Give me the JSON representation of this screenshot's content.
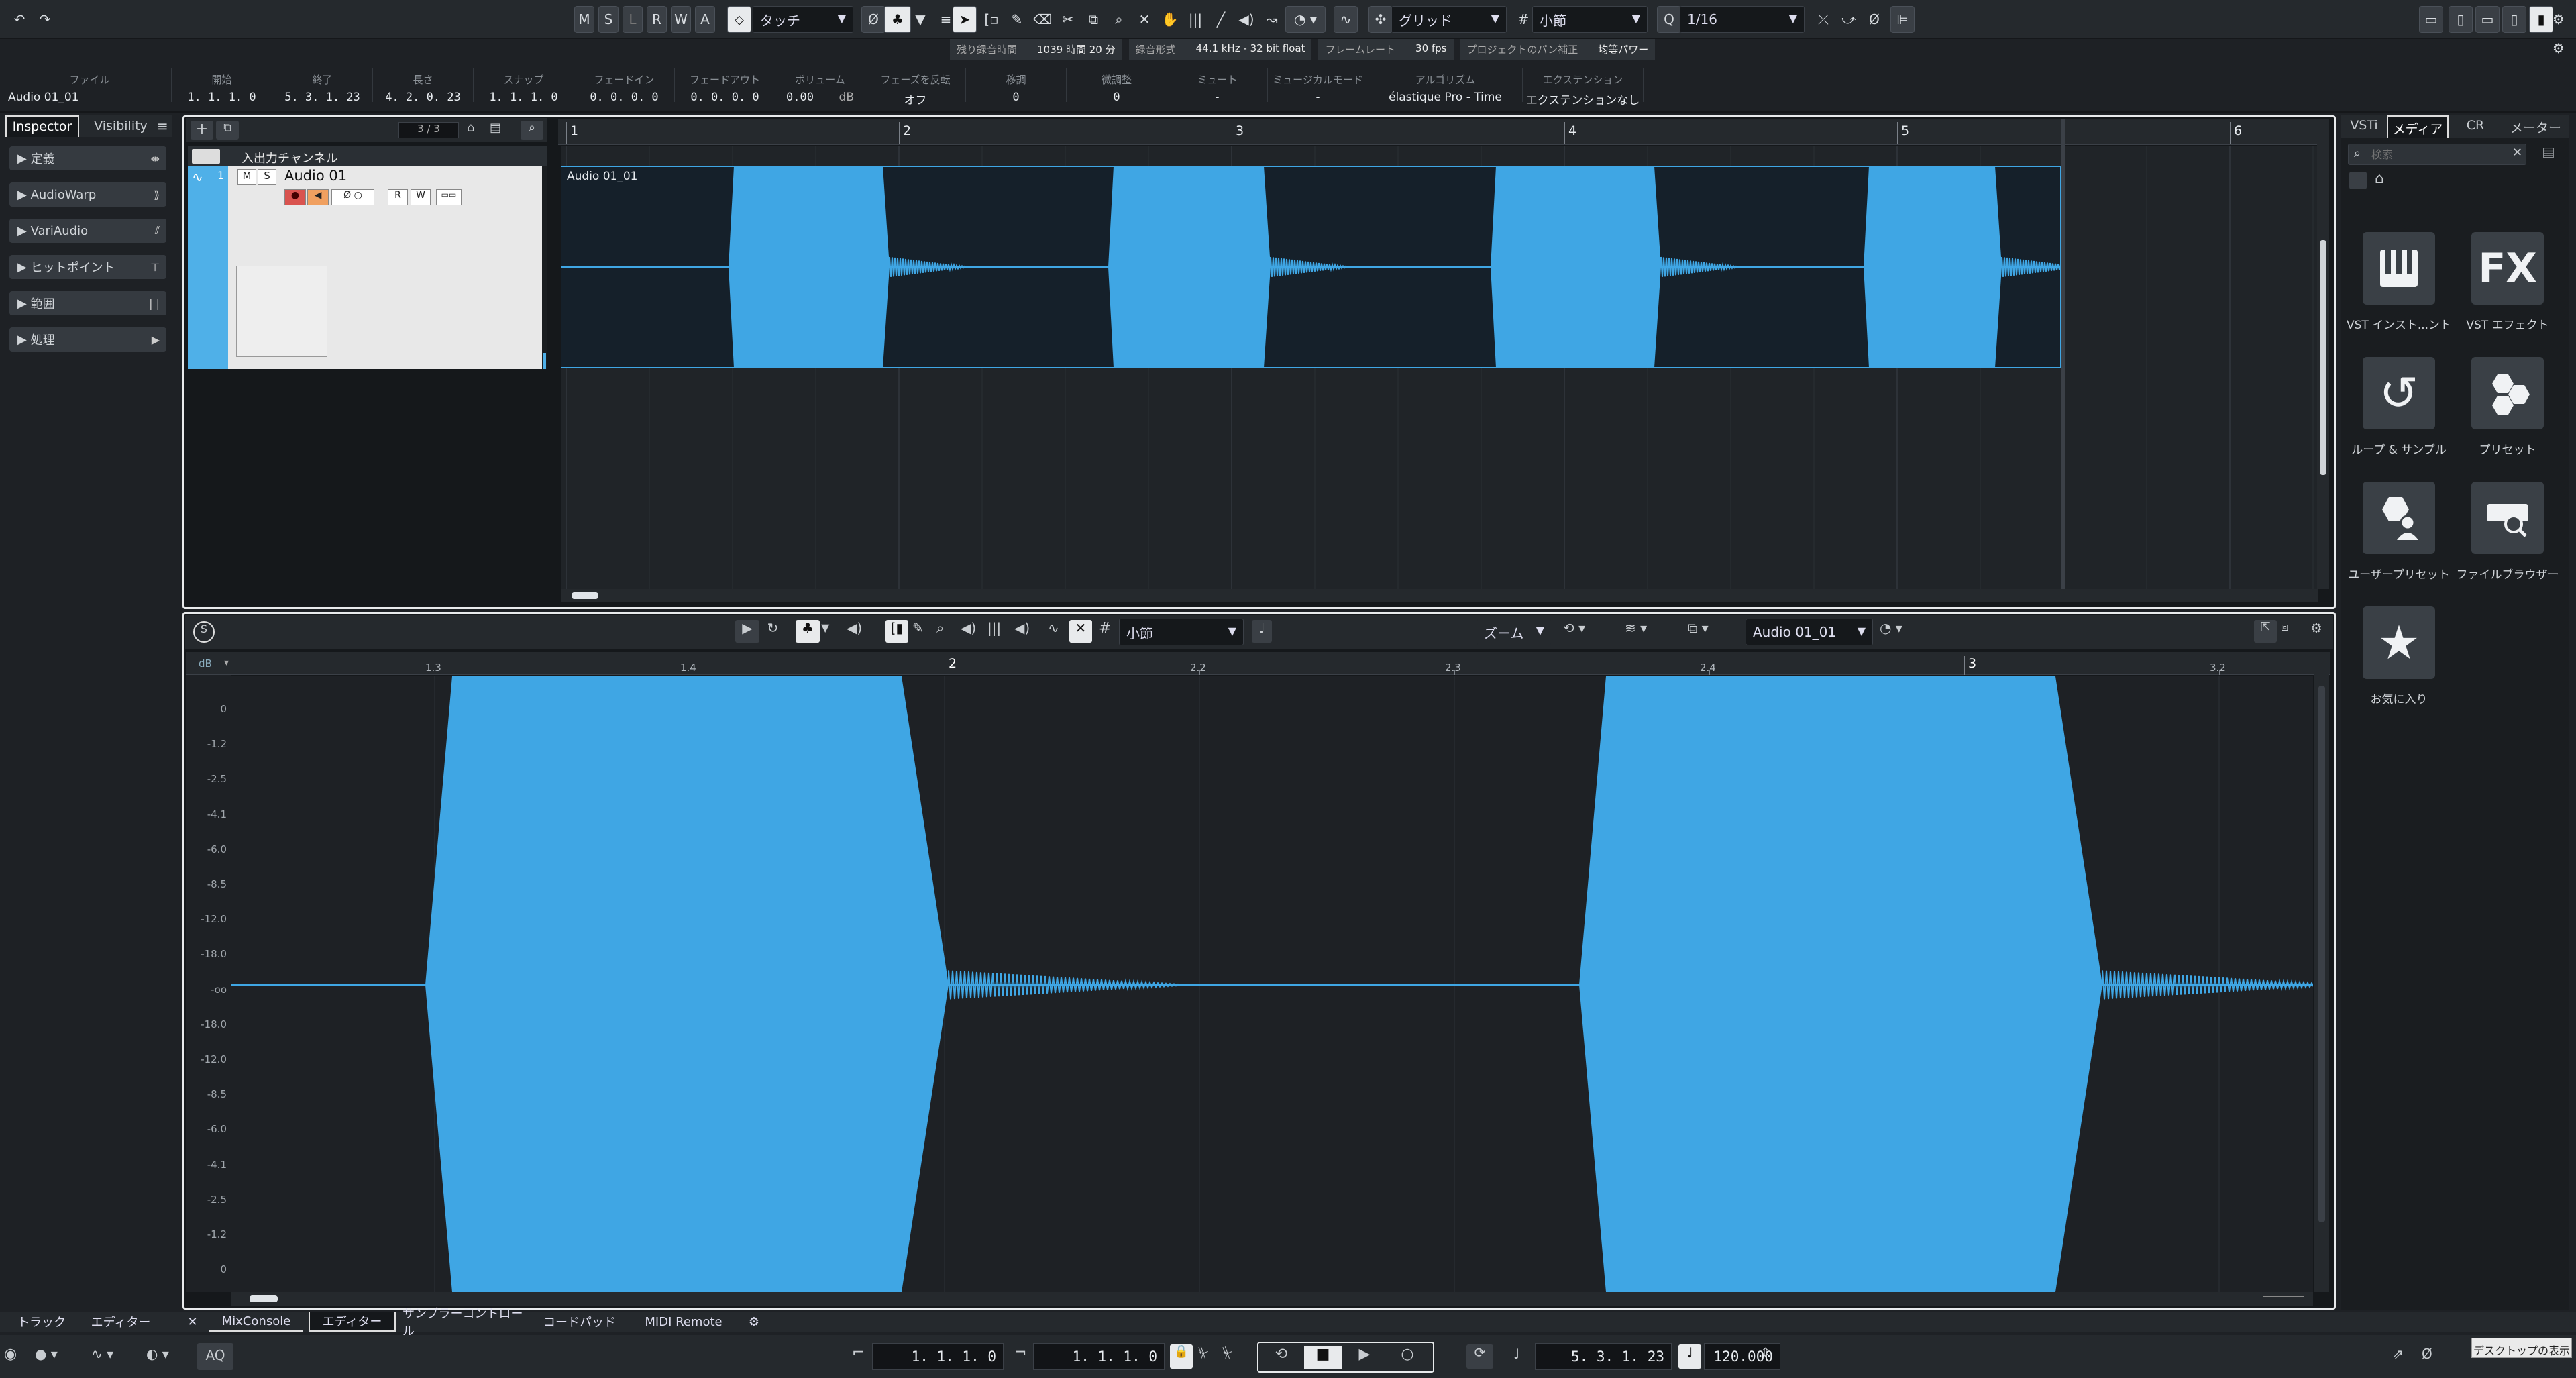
{
  "toolbar": {
    "mode_buttons": [
      "M",
      "S",
      "L",
      "R",
      "W",
      "A"
    ],
    "automation_mode": "タッチ",
    "snap_type": "グリッド",
    "grid_type": "小節",
    "quantize": "1/16"
  },
  "status_row": {
    "items": [
      {
        "label": "残り録音時間",
        "value": "1039 時間 20 分"
      },
      {
        "label": "録音形式",
        "value": "44.1 kHz - 32 bit float"
      },
      {
        "label": "フレームレート",
        "value": "30 fps"
      },
      {
        "label": "プロジェクトのパン補正",
        "value": "均等パワー"
      }
    ]
  },
  "info_line": {
    "fields": [
      {
        "label": "ファイル",
        "value": "Audio 01_01"
      },
      {
        "label": "開始",
        "value": "1. 1. 1.   0"
      },
      {
        "label": "終了",
        "value": "5. 3. 1. 23"
      },
      {
        "label": "長さ",
        "value": "4. 2. 0. 23"
      },
      {
        "label": "スナップ",
        "value": "1. 1. 1.   0"
      },
      {
        "label": "フェードイン",
        "value": "0. 0. 0.   0"
      },
      {
        "label": "フェードアウト",
        "value": "0. 0. 0.   0"
      },
      {
        "label": "ボリューム",
        "value": "0.00"
      },
      {
        "label": "",
        "value": "dB"
      },
      {
        "label": "フェーズを反転",
        "value": "オフ"
      },
      {
        "label": "移調",
        "value": "0"
      },
      {
        "label": "微調整",
        "value": "0"
      },
      {
        "label": "ミュート",
        "value": "-"
      },
      {
        "label": "ミュージカルモード",
        "value": "-"
      },
      {
        "label": "アルゴリズム",
        "value": "élastique Pro - Time"
      },
      {
        "label": "エクステンション",
        "value": "エクステンションなし"
      }
    ]
  },
  "inspector": {
    "tab_inspector": "Inspector",
    "tab_visibility": "Visibility",
    "sections": [
      "定義",
      "AudioWarp",
      "VariAudio",
      "ヒットポイント",
      "範囲",
      "処理"
    ]
  },
  "tracklist": {
    "count": "3 / 3",
    "folder_name": "入出力チャンネル",
    "track_number": "1",
    "track_name": "Audio 01",
    "mute": "M",
    "solo": "S",
    "read": "R",
    "write": "W"
  },
  "project": {
    "ruler_marks": [
      "1",
      "2",
      "3",
      "4",
      "5",
      "6"
    ],
    "clip_name": "Audio 01_01"
  },
  "editor": {
    "grid": "小節",
    "zoom": "ズーム",
    "event": "Audio 01_01",
    "db_unit": "dB",
    "ruler_marks": [
      "1.3",
      "1.4",
      "2",
      "2.2",
      "2.3",
      "2.4",
      "3",
      "3.2"
    ],
    "db_scale": [
      "0",
      "-1.2",
      "-2.5",
      "-4.1",
      "-6.0",
      "-8.5",
      "-12.0",
      "-18.0",
      "-oo",
      "-18.0",
      "-12.0",
      "-8.5",
      "-6.0",
      "-4.1",
      "-2.5",
      "-1.2",
      "0"
    ]
  },
  "right_zone": {
    "tabs": [
      "VSTi",
      "メディア",
      "CR",
      "メーター"
    ],
    "search_placeholder": "検索",
    "tiles": [
      {
        "label": "VST インスト...ント",
        "icon": "piano-icon"
      },
      {
        "label": "VST エフェクト",
        "icon": "fx-icon"
      },
      {
        "label": "ループ & サンプル",
        "icon": "loop-icon"
      },
      {
        "label": "プリセット",
        "icon": "preset-icon"
      },
      {
        "label": "ユーザープリセット",
        "icon": "user-preset-icon"
      },
      {
        "label": "ファイルブラウザー",
        "icon": "file-browser-icon"
      },
      {
        "label": "お気に入り",
        "icon": "star-icon"
      }
    ],
    "fx_text": "FX"
  },
  "lower_zone": {
    "left_tabs": [
      "トラック",
      "エディター"
    ],
    "tabs": [
      "MixConsole",
      "エディター",
      "サンプラーコントロール",
      "コードパッド",
      "MIDI Remote"
    ]
  },
  "transport": {
    "aq": "AQ",
    "left_locator": "1. 1. 1.   0",
    "right_locator": "1. 1. 1.   0",
    "position": "5. 3. 1. 23",
    "tempo": "120.000"
  },
  "tooltip": "デスクトップの表示",
  "colors": {
    "waveform": "#3fa6e4",
    "accent": "#4fb0e8",
    "record": "#d9534f"
  }
}
